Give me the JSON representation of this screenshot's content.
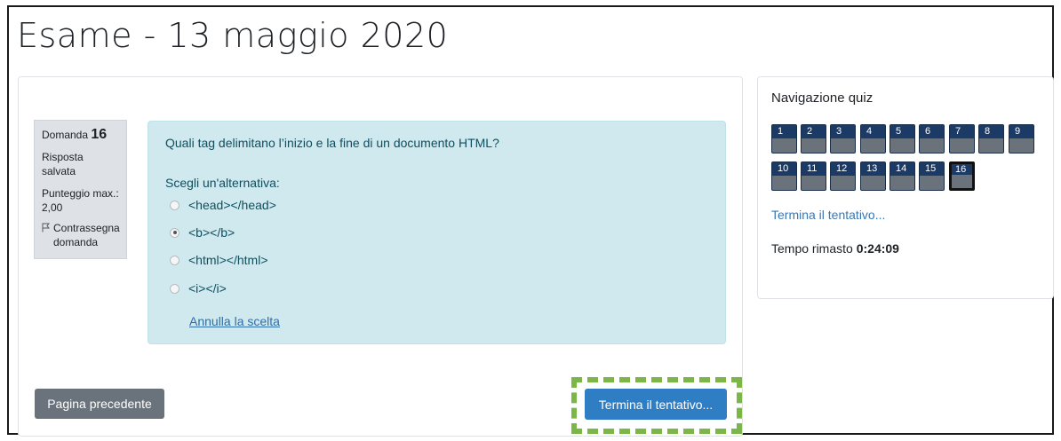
{
  "page": {
    "title": "Esame - 13 maggio 2020"
  },
  "question_info": {
    "label": "Domanda",
    "number": "16",
    "status": "Risposta salvata",
    "max_score_label": "Punteggio max.:",
    "max_score_value": "2,00",
    "flag_label": "Contrassegna domanda",
    "flag_icon": "flag-icon"
  },
  "question": {
    "text": "Quali tag delimitano l’inizio e la fine di un documento HTML?",
    "prompt": "Scegli un'alternativa:",
    "options": [
      {
        "label": "<head></head>",
        "selected": false
      },
      {
        "label": "<b></b>",
        "selected": true
      },
      {
        "label": "<html></html>",
        "selected": false
      },
      {
        "label": "<i></i>",
        "selected": false
      }
    ],
    "clear_label": "Annulla la scelta"
  },
  "footer": {
    "prev_label": "Pagina precedente",
    "finish_label": "Termina il tentativo..."
  },
  "nav": {
    "title": "Navigazione quiz",
    "questions": [
      "1",
      "2",
      "3",
      "4",
      "5",
      "6",
      "7",
      "8",
      "9",
      "10",
      "11",
      "12",
      "13",
      "14",
      "15",
      "16"
    ],
    "current": "16",
    "finish_link": "Termina il tentativo...",
    "time_label": "Tempo rimasto",
    "time_value": "0:24:09"
  },
  "colors": {
    "highlight": "#7ab648",
    "primary_button": "#2f7ec3",
    "question_bg": "#cfe9ee",
    "nav_button": "#1b3a66"
  }
}
